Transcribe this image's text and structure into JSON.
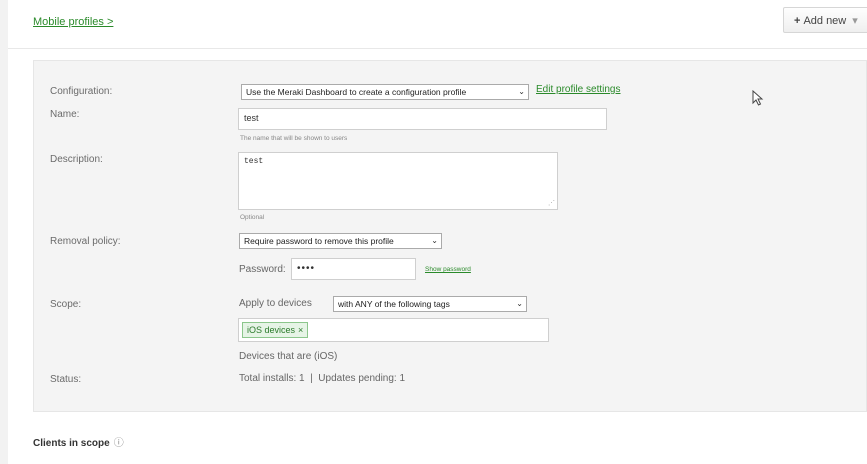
{
  "breadcrumb": "Mobile profiles >",
  "toolbar": {
    "add_new_label": "Add new"
  },
  "form": {
    "configuration": {
      "label": "Configuration:",
      "selected": "Use the Meraki Dashboard to create a configuration profile",
      "edit_link": "Edit profile settings"
    },
    "name": {
      "label": "Name:",
      "value": "test",
      "hint": "The name that will be shown to users"
    },
    "description": {
      "label": "Description:",
      "value": "test",
      "hint": "Optional"
    },
    "removal_policy": {
      "label": "Removal policy:",
      "selected": "Require password to remove this profile",
      "password_label": "Password:",
      "password_value": "••••",
      "show_password_link": "Show password"
    },
    "scope": {
      "label": "Scope:",
      "apply_label": "Apply to devices",
      "selected": "with ANY of the following tags",
      "tags": [
        "iOS devices"
      ],
      "devices_note": "Devices that are (iOS)"
    },
    "status": {
      "label": "Status:",
      "text": "Total installs: 1  |  Updates pending: 1"
    }
  },
  "clients_section": {
    "title": "Clients in scope"
  }
}
